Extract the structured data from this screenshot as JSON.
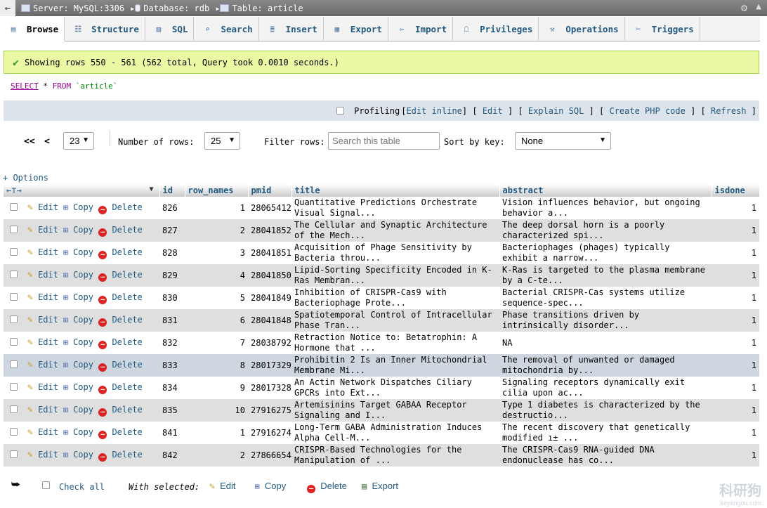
{
  "topbar": {
    "server": "Server: MySQL:3306",
    "database": "Database: rdb",
    "table": "Table: article"
  },
  "tabs": [
    {
      "label": "Browse",
      "icon": "browse-icon",
      "active": true
    },
    {
      "label": "Structure",
      "icon": "structure-icon"
    },
    {
      "label": "SQL",
      "icon": "sql-icon"
    },
    {
      "label": "Search",
      "icon": "search-icon"
    },
    {
      "label": "Insert",
      "icon": "insert-icon"
    },
    {
      "label": "Export",
      "icon": "export-icon"
    },
    {
      "label": "Import",
      "icon": "import-icon"
    },
    {
      "label": "Privileges",
      "icon": "privileges-icon"
    },
    {
      "label": "Operations",
      "icon": "operations-icon"
    },
    {
      "label": "Triggers",
      "icon": "triggers-icon"
    }
  ],
  "message": "Showing rows 550 - 561 (562 total, Query took 0.0010 seconds.)",
  "sql": {
    "select": "SELECT",
    "star": " * ",
    "from": "FROM",
    "table": " `article`"
  },
  "profile": {
    "label": "Profiling",
    "edit_inline": "Edit inline",
    "edit": "Edit",
    "explain": "Explain SQL",
    "php": "Create PHP code",
    "refresh": "Refresh"
  },
  "nav": {
    "first": "<<",
    "prev": "<",
    "page": "23",
    "rows_label": "Number of rows:",
    "rows_value": "25",
    "filter_label": "Filter rows:",
    "filter_placeholder": "Search this table",
    "sort_label": "Sort by key:",
    "sort_value": "None"
  },
  "options": "+ Options",
  "columns": [
    "id",
    "row_names",
    "pmid",
    "title",
    "abstract",
    "isdone"
  ],
  "actions": {
    "edit": "Edit",
    "copy": "Copy",
    "delete": "Delete"
  },
  "rows": [
    {
      "id": "826",
      "row_names": "1",
      "pmid": "28065412",
      "title": "Quantitative Predictions Orchestrate Visual Signal...",
      "abstract": "Vision influences behavior, but ongoing behavior a...",
      "isdone": "1"
    },
    {
      "id": "827",
      "row_names": "2",
      "pmid": "28041852",
      "title": "The Cellular and Synaptic Architecture of the Mech...",
      "abstract": "The deep dorsal horn is a poorly characterized spi...",
      "isdone": "1"
    },
    {
      "id": "828",
      "row_names": "3",
      "pmid": "28041851",
      "title": "Acquisition of Phage Sensitivity by Bacteria throu...",
      "abstract": "Bacteriophages (phages) typically exhibit a narrow...",
      "isdone": "1"
    },
    {
      "id": "829",
      "row_names": "4",
      "pmid": "28041850",
      "title": "Lipid-Sorting Specificity Encoded in K-Ras Membran...",
      "abstract": "K-Ras is targeted to the plasma membrane by a C-te...",
      "isdone": "1"
    },
    {
      "id": "830",
      "row_names": "5",
      "pmid": "28041849",
      "title": "Inhibition of CRISPR-Cas9 with Bacteriophage Prote...",
      "abstract": "Bacterial CRISPR-Cas systems utilize sequence-spec...",
      "isdone": "1"
    },
    {
      "id": "831",
      "row_names": "6",
      "pmid": "28041848",
      "title": "Spatiotemporal Control of Intracellular Phase Tran...",
      "abstract": "Phase transitions driven by intrinsically disorder...",
      "isdone": "1"
    },
    {
      "id": "832",
      "row_names": "7",
      "pmid": "28038792",
      "title": "Retraction Notice to: Betatrophin: A Hormone that ...",
      "abstract": "NA",
      "isdone": "1"
    },
    {
      "id": "833",
      "row_names": "8",
      "pmid": "28017329",
      "title": "Prohibitin 2 Is an Inner Mitochondrial Membrane Mi...",
      "abstract": "The removal of unwanted or damaged mitochondria by...",
      "isdone": "1"
    },
    {
      "id": "834",
      "row_names": "9",
      "pmid": "28017328",
      "title": "An Actin Network Dispatches Ciliary GPCRs into Ext...",
      "abstract": "Signaling receptors dynamically exit cilia upon ac...",
      "isdone": "1"
    },
    {
      "id": "835",
      "row_names": "10",
      "pmid": "27916275",
      "title": "Artemisinins Target GABAA Receptor Signaling and I...",
      "abstract": "Type 1 diabetes is characterized by the destructio...",
      "isdone": "1"
    },
    {
      "id": "841",
      "row_names": "1",
      "pmid": "27916274",
      "title": "Long-Term GABA Administration Induces Alpha Cell-M...",
      "abstract": "The recent discovery that genetically modified ı± ...",
      "isdone": "1"
    },
    {
      "id": "842",
      "row_names": "2",
      "pmid": "27866654",
      "title": "CRISPR-Based Technologies for the Manipulation of ...",
      "abstract": "The CRISPR-Cas9 RNA-guided DNA endonuclease has co...",
      "isdone": "1"
    }
  ],
  "bottom": {
    "check_all": "Check all",
    "with_selected": "With selected:",
    "edit": "Edit",
    "copy": "Copy",
    "delete": "Delete",
    "export": "Export"
  },
  "watermark": {
    "main": "科研狗",
    "sub": "keyangou.com"
  }
}
